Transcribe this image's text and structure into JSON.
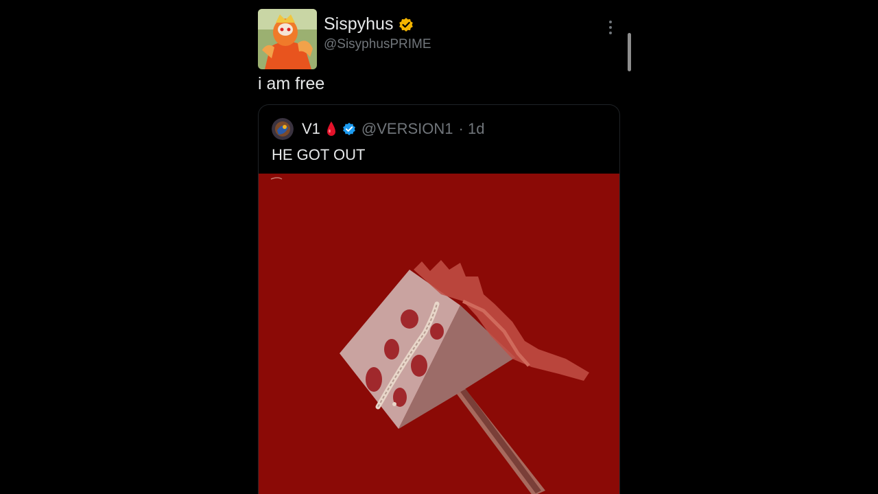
{
  "tweet": {
    "display_name": "Sispyhus",
    "handle": "@SisyphusPRIME",
    "text": "i am free",
    "verified_badge_color": "#f4b400",
    "avatar_icon": "prime-avatar-icon"
  },
  "quote": {
    "display_name": "V1",
    "handle": "@VERSION1",
    "time": "· 1d",
    "text": "HE GOT OUT",
    "name_emoji": "blood-drop-icon",
    "verified_badge_color": "#1d9bf0",
    "media_background": "#8b0a06",
    "media_subject": "bloody-hammer-image"
  },
  "colors": {
    "background": "#000000",
    "primary_text": "#e7e9ea",
    "secondary_text": "#71767b"
  }
}
